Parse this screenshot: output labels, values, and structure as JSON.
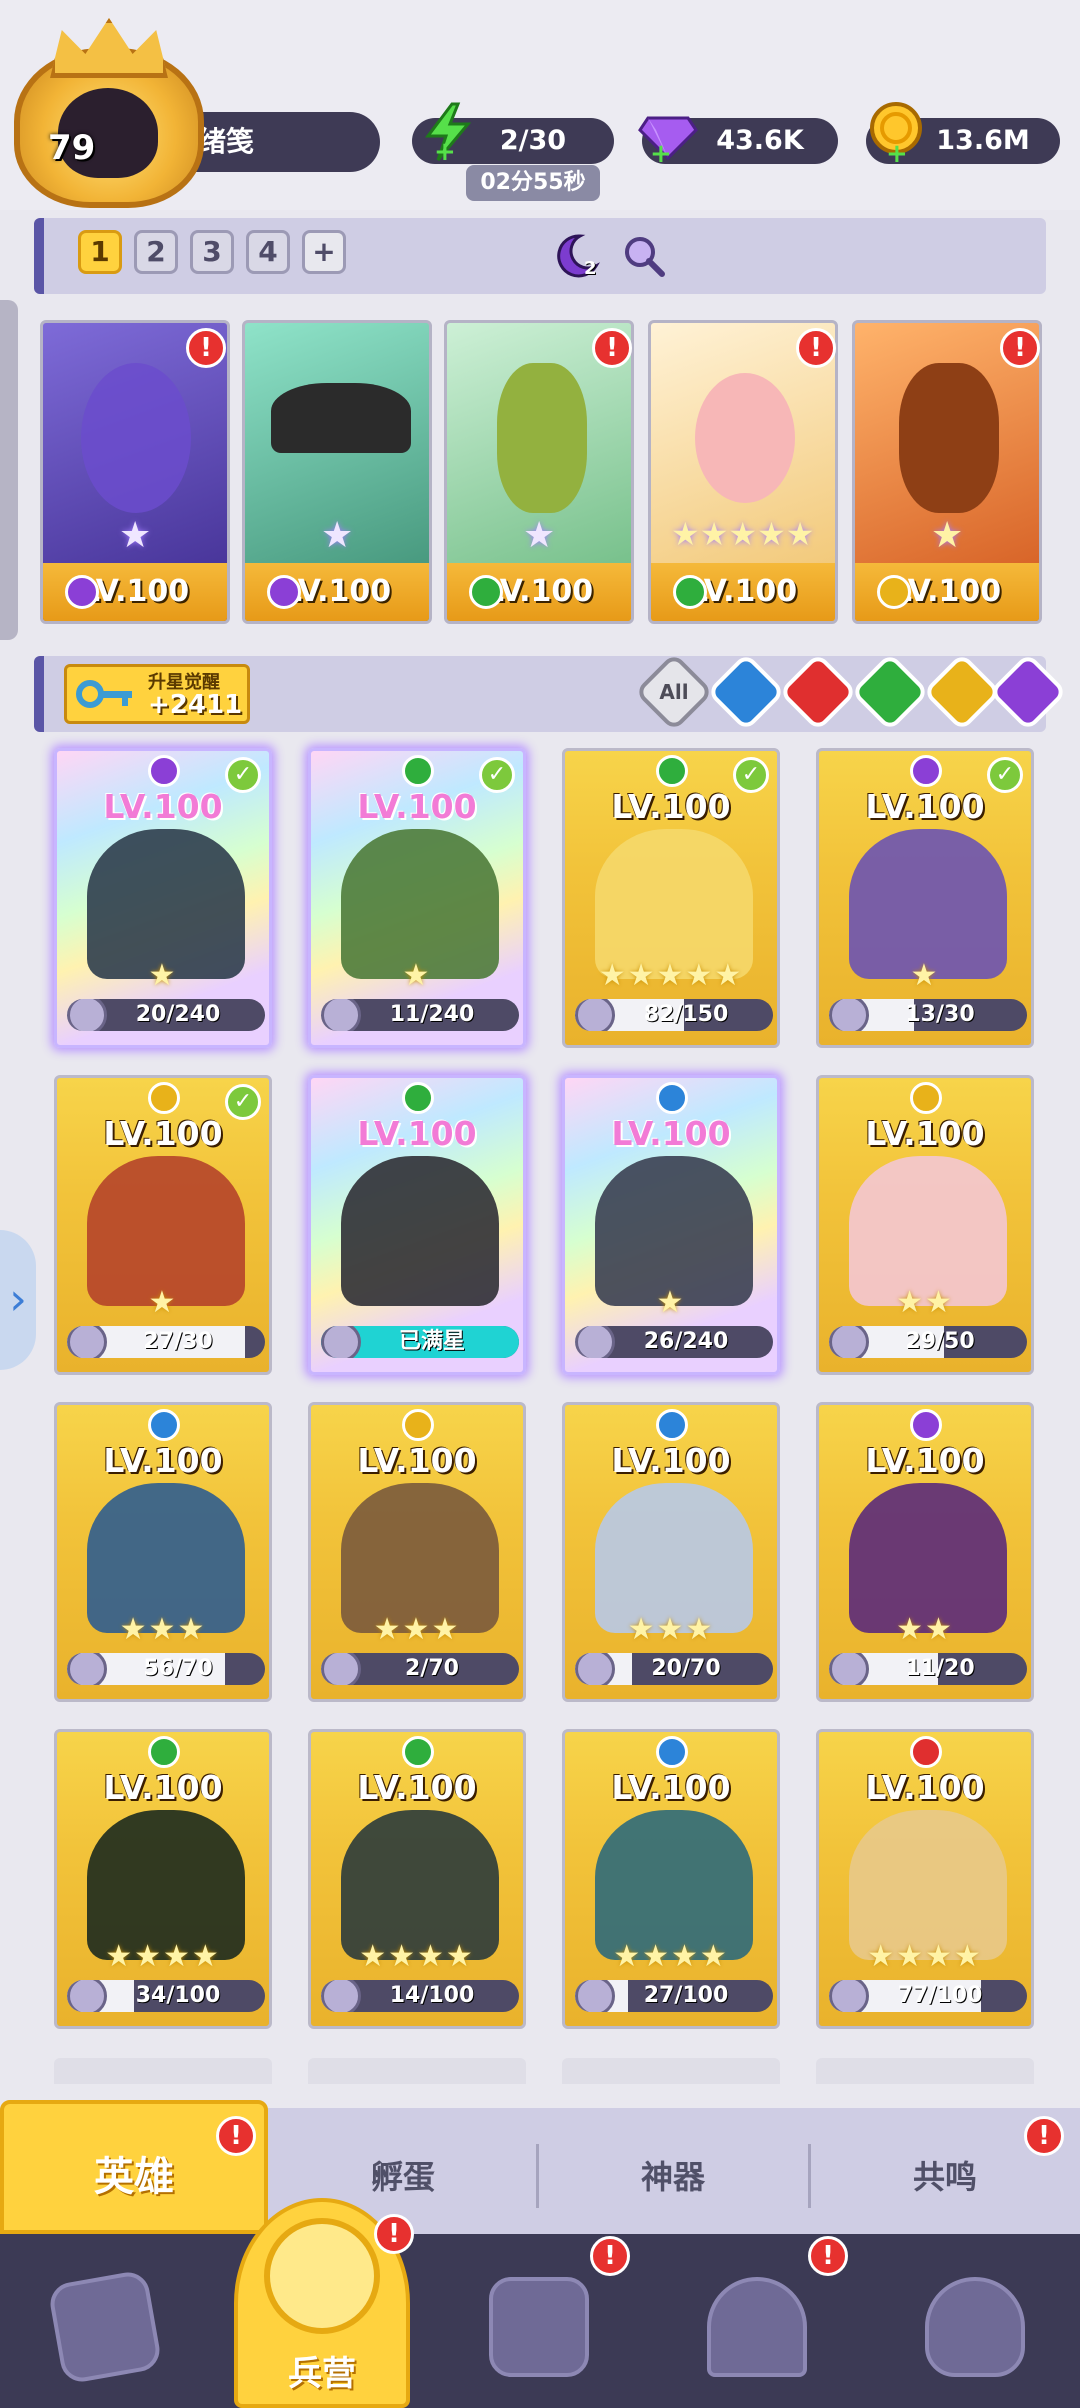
{
  "player": {
    "level": "79",
    "name": "杨绪笺"
  },
  "resources": {
    "energy": "2/30",
    "energy_timer": "02分55秒",
    "gems": "43.6K",
    "gold": "13.6M"
  },
  "colors": {
    "accent": "#ffd23e",
    "panel": "#cfcde4",
    "dark": "#3c3a55",
    "alert": "#e7312f",
    "element_dark": "#8b3fd6",
    "element_nature": "#2fae3d",
    "element_light": "#e8b21a",
    "element_water": "#2c84d9",
    "element_fire": "#e02f2f"
  },
  "team": {
    "slots": [
      "1",
      "2",
      "3",
      "4",
      "+"
    ],
    "active_slot": "1",
    "badge_count": "2",
    "heroes": [
      {
        "level": "LV.100",
        "element": "dark",
        "alert": "!"
      },
      {
        "level": "LV.100",
        "element": "dark",
        "alert": ""
      },
      {
        "level": "LV.100",
        "element": "nature",
        "alert": "!"
      },
      {
        "level": "LV.100",
        "element": "nature",
        "alert": "!"
      },
      {
        "level": "LV.100",
        "element": "light",
        "alert": "!"
      }
    ]
  },
  "awaken": {
    "title": "升星觉醒",
    "value": "+2411"
  },
  "filters": {
    "all_label": "All",
    "elements": [
      "water",
      "fire",
      "nature",
      "light",
      "dark"
    ]
  },
  "heroes": [
    {
      "level": "LV.100",
      "element": "dark",
      "progress": "20/240",
      "fraction": 0.083,
      "checked": true,
      "rainbow": true,
      "stars": "★"
    },
    {
      "level": "LV.100",
      "element": "nature",
      "progress": "11/240",
      "fraction": 0.046,
      "checked": true,
      "rainbow": true,
      "stars": "★"
    },
    {
      "level": "LV.100",
      "element": "nature",
      "progress": "82/150",
      "fraction": 0.547,
      "checked": true,
      "rainbow": false,
      "stars": "★★★★★"
    },
    {
      "level": "LV.100",
      "element": "dark",
      "progress": "13/30",
      "fraction": 0.433,
      "checked": true,
      "rainbow": false,
      "stars": "★"
    },
    {
      "level": "LV.100",
      "element": "light",
      "progress": "27/30",
      "fraction": 0.9,
      "checked": true,
      "rainbow": false,
      "stars": "★"
    },
    {
      "level": "LV.100",
      "element": "nature",
      "progress": "已满星",
      "fraction": 1.0,
      "checked": false,
      "rainbow": true,
      "stars": ""
    },
    {
      "level": "LV.100",
      "element": "water",
      "progress": "26/240",
      "fraction": 0.108,
      "checked": false,
      "rainbow": true,
      "stars": "★"
    },
    {
      "level": "LV.100",
      "element": "light",
      "progress": "29/50",
      "fraction": 0.58,
      "checked": false,
      "rainbow": false,
      "stars": "★★"
    },
    {
      "level": "LV.100",
      "element": "water",
      "progress": "56/70",
      "fraction": 0.8,
      "checked": false,
      "rainbow": false,
      "stars": "★★★"
    },
    {
      "level": "LV.100",
      "element": "light",
      "progress": "2/70",
      "fraction": 0.029,
      "checked": false,
      "rainbow": false,
      "stars": "★★★"
    },
    {
      "level": "LV.100",
      "element": "water",
      "progress": "20/70",
      "fraction": 0.286,
      "checked": false,
      "rainbow": false,
      "stars": "★★★"
    },
    {
      "level": "LV.100",
      "element": "dark",
      "progress": "11/20",
      "fraction": 0.55,
      "checked": false,
      "rainbow": false,
      "stars": "★★"
    },
    {
      "level": "LV.100",
      "element": "nature",
      "progress": "34/100",
      "fraction": 0.34,
      "checked": false,
      "rainbow": false,
      "stars": "★★★★"
    },
    {
      "level": "LV.100",
      "element": "nature",
      "progress": "14/100",
      "fraction": 0.14,
      "checked": false,
      "rainbow": false,
      "stars": "★★★★"
    },
    {
      "level": "LV.100",
      "element": "water",
      "progress": "27/100",
      "fraction": 0.27,
      "checked": false,
      "rainbow": false,
      "stars": "★★★★"
    },
    {
      "level": "LV.100",
      "element": "fire",
      "progress": "77/100",
      "fraction": 0.77,
      "checked": false,
      "rainbow": false,
      "stars": "★★★★"
    }
  ],
  "subtabs": [
    "英雄",
    "孵蛋",
    "神器",
    "共鸣"
  ],
  "subtab_alerts": [
    "!",
    "",
    "",
    "!"
  ],
  "nav": {
    "active_label": "兵营",
    "items": [
      "cards-icon",
      "barracks-icon",
      "map-icon",
      "castle-icon",
      "mushroom-icon"
    ],
    "alerts": [
      "",
      "!",
      "!",
      "!",
      ""
    ]
  }
}
